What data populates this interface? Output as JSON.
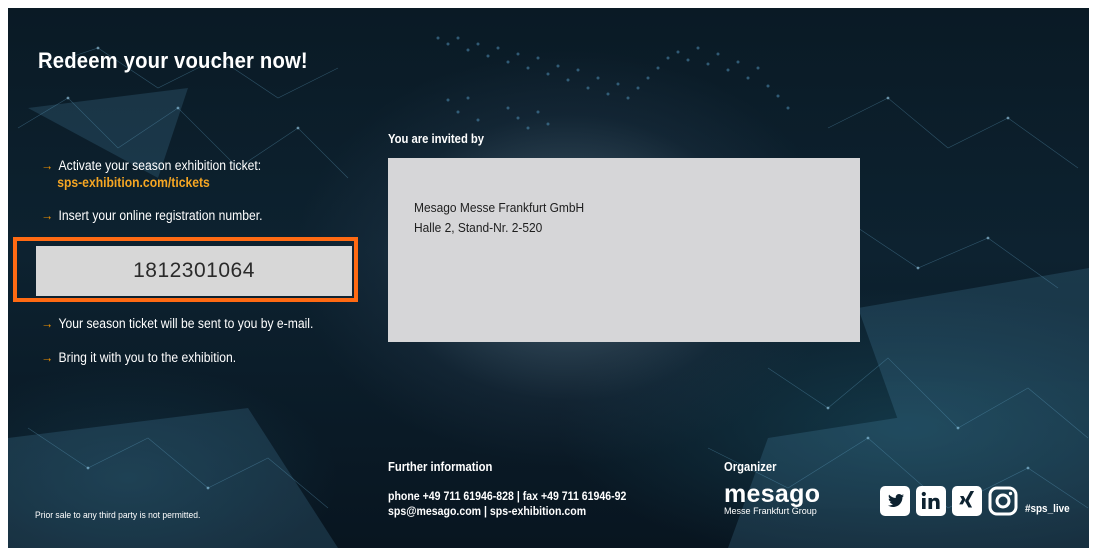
{
  "voucher": {
    "title": "Redeem your voucher now!",
    "steps": {
      "activate": "Activate your season exhibition ticket:",
      "activate_link": "sps-exhibition.com/tickets",
      "insert": "Insert your online registration number.",
      "email": "Your season ticket will be sent to you by e-mail.",
      "bring": "Bring it with you to the exhibition."
    },
    "registration_number": "1812301064",
    "disclaimer": "Prior sale to any third party is not permitted."
  },
  "invitation": {
    "label": "You are invited by",
    "company": "Mesago Messe Frankfurt GmbH",
    "stand": "Halle 2, Stand-Nr. 2-520"
  },
  "footer": {
    "further_label": "Further information",
    "phone_line": "phone +49 711 61946-828 | fax +49 711 61946-92",
    "email_line": "sps@mesago.com | sps-exhibition.com",
    "organizer_label": "Organizer",
    "organizer_name": "mesago",
    "organizer_sub": "Messe Frankfurt Group",
    "hashtag": "#sps_live",
    "social_icons": [
      "twitter-icon",
      "linkedin-icon",
      "xing-icon",
      "instagram-icon"
    ]
  },
  "colors": {
    "accent": "#f29300",
    "highlight_frame": "#ff6a13",
    "box_fill": "#d6d6d8",
    "background": "#0d2230"
  }
}
